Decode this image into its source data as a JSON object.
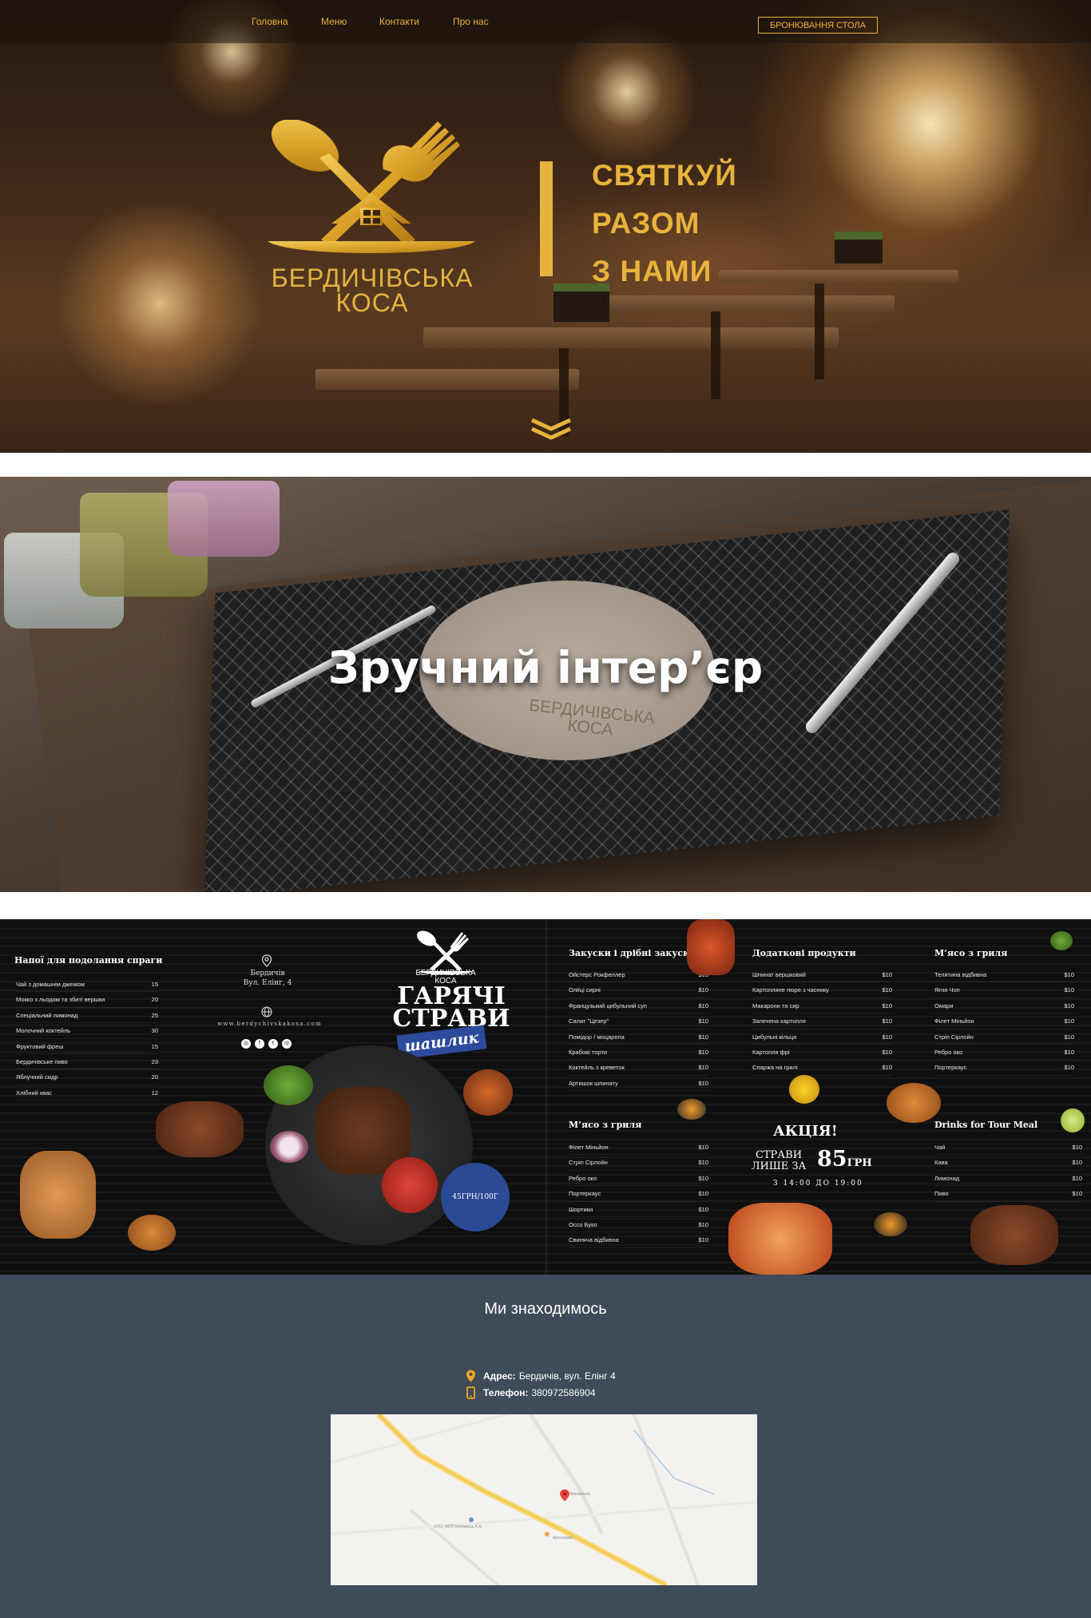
{
  "nav": {
    "links": [
      "Головна",
      "Меню",
      "Контакти",
      "Про нас"
    ],
    "book_button": "БРОНЮВАННЯ СТОЛА"
  },
  "hero": {
    "brand_line1": "БЕРДИЧІВСЬКА",
    "brand_line2": "КОСА",
    "slogan": [
      "СВЯТКУЙ",
      "РАЗОМ",
      "З НАМИ"
    ]
  },
  "interior": {
    "title": "Зручний інтер’єр",
    "plate_text_line1": "БЕРДИЧІВСЬКА",
    "plate_text_line2": "КОСА"
  },
  "menu": {
    "drinks": {
      "title": "Напої для подолання спраги",
      "items": [
        {
          "name": "Чай з домашнім джемом",
          "price": "15"
        },
        {
          "name": "Мокко з льодом та збиті вершки",
          "price": "20"
        },
        {
          "name": "Спеціальний лимонад",
          "price": "25"
        },
        {
          "name": "Молочний коктейль",
          "price": "30"
        },
        {
          "name": "Фруктовий фреш",
          "price": "15"
        },
        {
          "name": "Бердичівське пиво",
          "price": "23"
        },
        {
          "name": "Яблучний сидр",
          "price": "20"
        },
        {
          "name": "Хлібний квас",
          "price": "12"
        }
      ]
    },
    "address_line1": "Бердичів",
    "address_line2": "Вул. Елінг, 4",
    "website": "www.berdychivskakosa.com",
    "brand_line1": "БЕРДИЧІВСЬКА",
    "brand_line2": "КОСА",
    "hot_line1": "ГАРЯЧІ",
    "hot_line2": "СТРАВИ",
    "shashlyk": "шашлик",
    "price_badge": "45ГРН/100Г",
    "snacks": {
      "title": "Закуски і дрібні закуски",
      "items": [
        {
          "name": "Ойстерс Рокфеллер",
          "price": "$10"
        },
        {
          "name": "Оліїці сирні",
          "price": "$10"
        },
        {
          "name": "Французький цибульний суп",
          "price": "$10"
        },
        {
          "name": "Салат \"Цезер\"",
          "price": "$10"
        },
        {
          "name": "Помідор / моцарела",
          "price": "$10"
        },
        {
          "name": "Крабові торти",
          "price": "$10"
        },
        {
          "name": "Коктейль з креветок",
          "price": "$10"
        },
        {
          "name": "Артишок шпинату",
          "price": "$10"
        }
      ]
    },
    "extras": {
      "title": "Додаткові продукти",
      "items": [
        {
          "name": "Шпинат вершковий",
          "price": "$10"
        },
        {
          "name": "Картопляне пюре з часнику",
          "price": "$10"
        },
        {
          "name": "Макарони та сир",
          "price": "$10"
        },
        {
          "name": "Запечена картопля",
          "price": "$10"
        },
        {
          "name": "Цибульні кільця",
          "price": "$10"
        },
        {
          "name": "Картопля фрі",
          "price": "$10"
        },
        {
          "name": "Спаржа на грилі",
          "price": "$10"
        }
      ]
    },
    "grill_right": {
      "title": "М’ясо з гриля",
      "items": [
        {
          "name": "Телятина відбивна",
          "price": "$10"
        },
        {
          "name": "Ягня Чоп",
          "price": "$10"
        },
        {
          "name": "Омари",
          "price": "$10"
        },
        {
          "name": "Філет Міньйон",
          "price": "$10"
        },
        {
          "name": "Стріп Сірлойн",
          "price": "$10"
        },
        {
          "name": "Ребро око",
          "price": "$10"
        },
        {
          "name": "Портеркаус",
          "price": "$10"
        }
      ]
    },
    "grill_left": {
      "title": "М’ясо з гриля",
      "items": [
        {
          "name": "Філет Міньйон",
          "price": "$10"
        },
        {
          "name": "Стріп Сірлойн",
          "price": "$10"
        },
        {
          "name": "Ребро око",
          "price": "$10"
        },
        {
          "name": "Портеркаус",
          "price": "$10"
        },
        {
          "name": "Шортики",
          "price": "$10"
        },
        {
          "name": "Оссо Буко",
          "price": "$10"
        },
        {
          "name": "Свиняча відбивна",
          "price": "$10"
        }
      ]
    },
    "promo": {
      "title": "АКЦІЯ!",
      "line1": "СТРАВИ",
      "line2": "ЛИШЕ ЗА",
      "price": "85",
      "currency": "ГРН",
      "time": "З 14:00 ДО 19:00"
    },
    "tour_drinks": {
      "title": "Drinks for Tour Meal",
      "items": [
        {
          "name": "Чай",
          "price": "$10"
        },
        {
          "name": "Кава",
          "price": "$10"
        },
        {
          "name": "Лимонад",
          "price": "$10"
        },
        {
          "name": "Пиво",
          "price": "$10"
        }
      ]
    }
  },
  "location": {
    "title": "Ми знаходимось",
    "address_label": "Адрес:",
    "address_value": "Бердичів, вул. Елінг 4",
    "phone_label": "Телефон:",
    "phone_value": "380972586904",
    "map_labels": [
      "Вокзальна",
      "СТО, ФОП Коломієць К.А.",
      "Автосервіс"
    ]
  },
  "colors": {
    "gold": "#e8b33c",
    "nav_bg": "#1c120c",
    "location_bg": "#3f4b58",
    "menu_bg": "#0f0f0f",
    "badge_blue": "#2b4a95"
  },
  "icons": [
    "logo-emblem-icon",
    "chevron-down-icon",
    "location-pin-icon",
    "globe-icon",
    "instagram-icon",
    "facebook-icon",
    "twitter-icon",
    "phone-icon",
    "map-marker-icon"
  ]
}
